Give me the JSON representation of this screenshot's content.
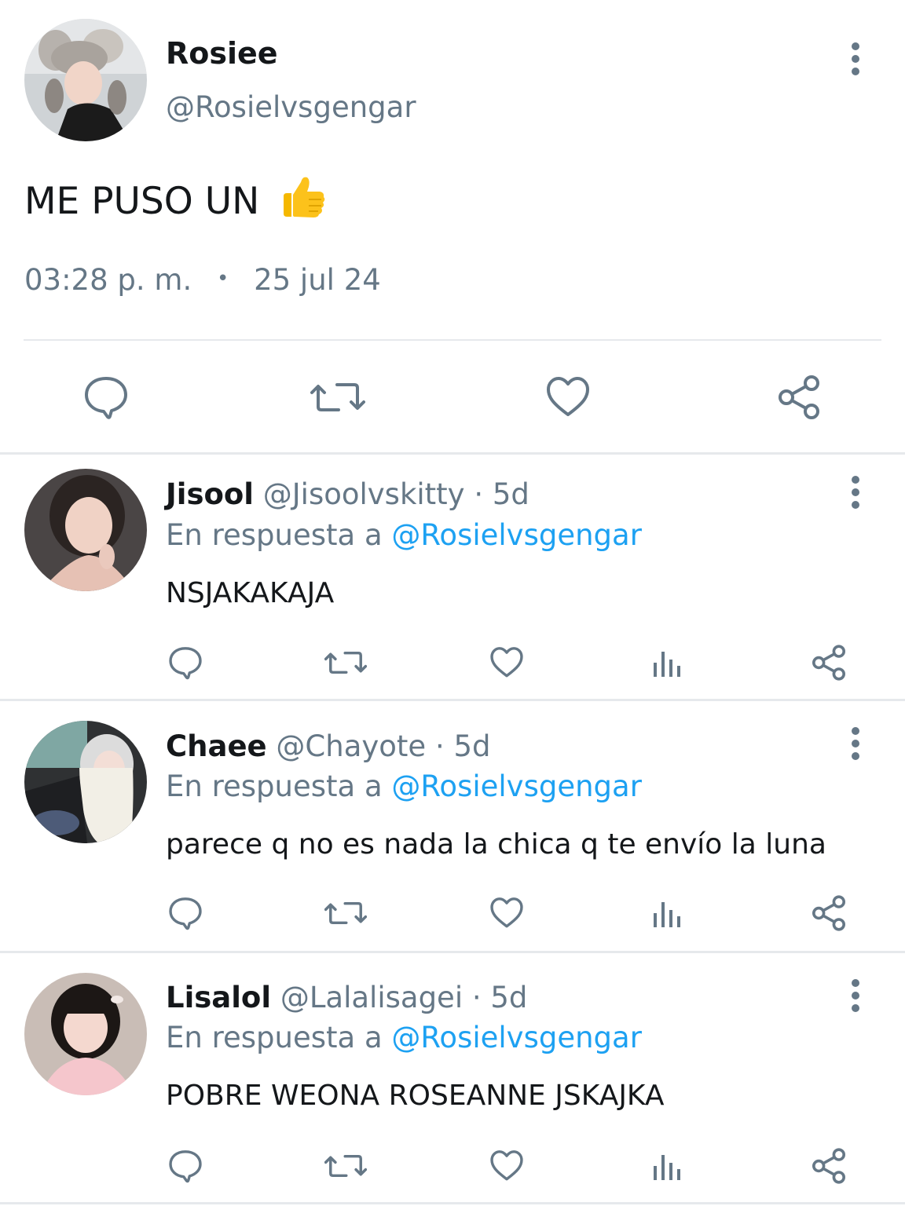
{
  "main_tweet": {
    "display_name": "Rosiee",
    "handle": "@Rosielvsgengar",
    "text": "ME PUSO UN",
    "emoji": "👍",
    "time": "03:28 p. m.",
    "separator": "•",
    "date": "25 jul 24",
    "actions": [
      "reply-icon",
      "retweet-icon",
      "like-icon",
      "share-icon"
    ]
  },
  "replies": [
    {
      "display_name": "Jisool",
      "handle": "@Jisoolvskitty",
      "age": "· 5d",
      "reply_prefix": "En respuesta a",
      "reply_to": "@Rosielvsgengar",
      "text": "NSJAKAKAJA"
    },
    {
      "display_name": "Chaee",
      "handle": "@Chayote",
      "age": "· 5d",
      "reply_prefix": "En respuesta a",
      "reply_to": "@Rosielvsgengar",
      "text": "parece q no es nada la chica q te envío la luna"
    },
    {
      "display_name": "Lisalol",
      "handle": "@Lalalisagei",
      "age": "· 5d",
      "reply_prefix": "En respuesta a",
      "reply_to": "@Rosielvsgengar",
      "text": "POBRE WEONA ROSEANNE JSKAJKA"
    }
  ],
  "colors": {
    "text": "#14171a",
    "secondary": "#657786",
    "link": "#1da1f2",
    "divider": "#e6e9ec"
  }
}
